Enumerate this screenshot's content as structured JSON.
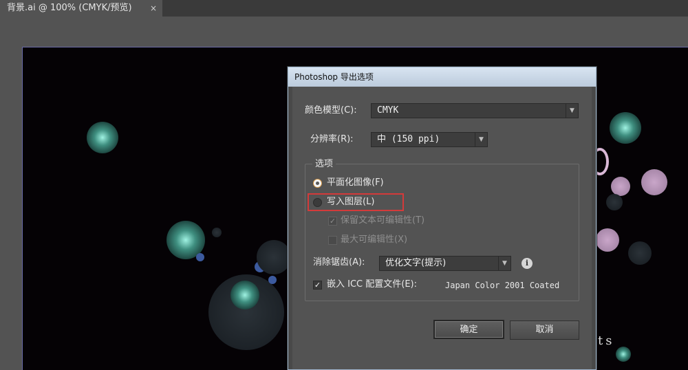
{
  "document_tab": {
    "title": "背景.ai @ 100% (CMYK/预览)",
    "close_glyph": "×"
  },
  "artwork": {
    "visible_text": "ts"
  },
  "dialog": {
    "title": "Photoshop 导出选项",
    "color_model": {
      "label": "颜色模型(C):",
      "value": "CMYK"
    },
    "resolution": {
      "label": "分辨率(R):",
      "value": "中 (150 ppi)"
    },
    "options": {
      "title": "选项",
      "flat_image": {
        "label": "平面化图像(F)",
        "selected": true
      },
      "write_layers": {
        "label": "写入图层(L)",
        "selected": false
      },
      "preserve_text": {
        "label": "保留文本可编辑性(T)",
        "checked": true,
        "enabled": false
      },
      "max_editability": {
        "label": "最大可编辑性(X)",
        "checked": false,
        "enabled": false
      },
      "anti_alias": {
        "label": "消除锯齿(A):",
        "value": "优化文字(提示)",
        "info_icon": "i"
      },
      "embed_icc": {
        "label": "嵌入 ICC 配置文件(E):",
        "profile": "Japan Color 2001 Coated",
        "checked": true
      }
    },
    "buttons": {
      "ok": "确定",
      "cancel": "取消"
    }
  },
  "colors": {
    "highlight": "#d43a3a",
    "radio_accent": "#d89a4a",
    "title_bar": "#c9d7e6",
    "artboard_bg": "#050205"
  }
}
